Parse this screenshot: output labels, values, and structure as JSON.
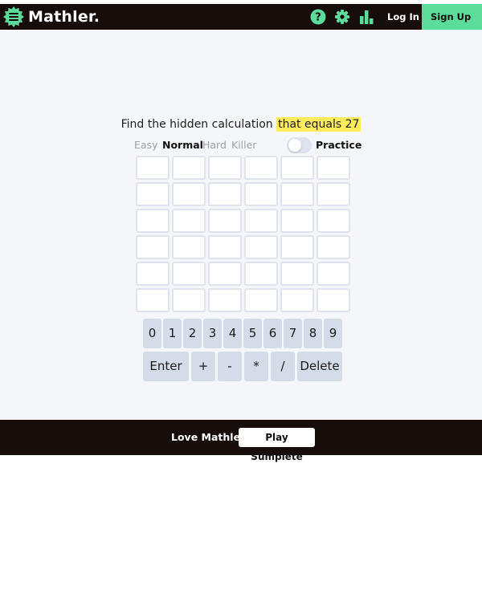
{
  "header": {
    "app_name": "Mathler.",
    "help_icon": "question-circle-icon",
    "settings_icon": "gear-icon",
    "stats_icon": "bar-chart-icon",
    "login_label": "Log In",
    "signup_label": "Sign Up",
    "signup_arrow": "→",
    "brand_color": "#5bdc9a",
    "bar_color": "#160c09"
  },
  "game": {
    "prompt_prefix": "Find the hidden calculation",
    "prompt_highlight": "that equals 27",
    "difficulties": [
      {
        "label": "Easy",
        "active": false
      },
      {
        "label": "Normal",
        "active": true
      },
      {
        "label": "Hard",
        "active": false
      },
      {
        "label": "Killer",
        "active": false
      }
    ],
    "practice_label": "Practice",
    "practice_enabled": false,
    "rows": 6,
    "columns": 6
  },
  "keyboard": {
    "digits": [
      "0",
      "1",
      "2",
      "3",
      "4",
      "5",
      "6",
      "7",
      "8",
      "9"
    ],
    "enter_label": "Enter",
    "operators": [
      "+",
      "-",
      "*",
      "/"
    ],
    "delete_label": "Delete"
  },
  "footer": {
    "love_text": "Love Mathler?",
    "play_label": "Play Sumplete"
  }
}
